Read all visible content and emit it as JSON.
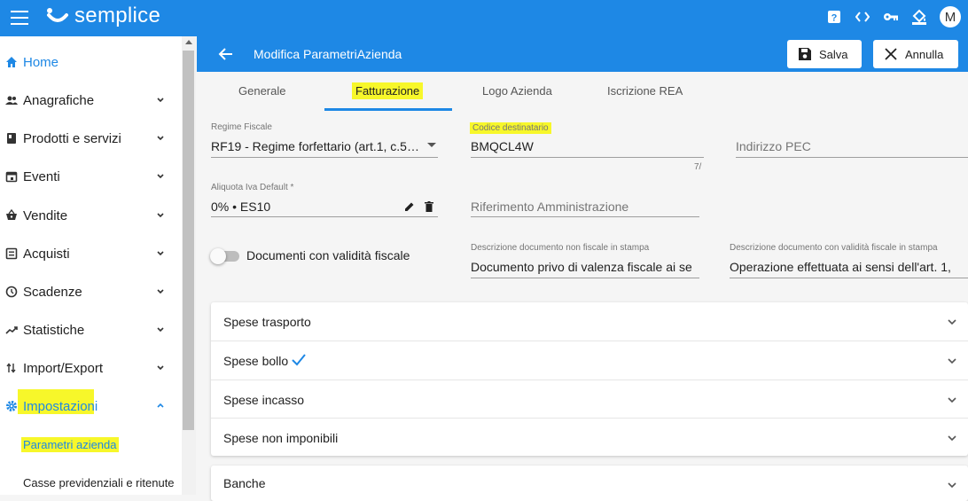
{
  "app": {
    "brand": "semplice",
    "avatar_initial": "M",
    "accent": "#1e88e5",
    "highlight": "#f7f72a"
  },
  "topbar_icons": [
    "help-icon",
    "code-icon",
    "key-icon",
    "format-paint-icon"
  ],
  "sidebar": {
    "items": [
      {
        "label": "Home",
        "icon": "home-icon",
        "active": true
      },
      {
        "label": "Anagrafiche",
        "icon": "people-icon"
      },
      {
        "label": "Prodotti e servizi",
        "icon": "book-icon"
      },
      {
        "label": "Eventi",
        "icon": "calendar-icon"
      },
      {
        "label": "Vendite",
        "icon": "basket-icon"
      },
      {
        "label": "Acquisti",
        "icon": "list-icon"
      },
      {
        "label": "Scadenze",
        "icon": "clock-icon"
      },
      {
        "label": "Statistiche",
        "icon": "trending-icon"
      },
      {
        "label": "Import/Export",
        "icon": "swap-icon"
      },
      {
        "label": "Impostazioni",
        "icon": "gear-icon",
        "active": true,
        "expanded": true
      }
    ],
    "subitems": [
      {
        "label": "Parametri azienda",
        "active": true
      },
      {
        "label": "Casse previdenziali e ritenute"
      }
    ]
  },
  "header": {
    "title": "Modifica ParametriAzienda",
    "save_label": "Salva",
    "cancel_label": "Annulla"
  },
  "tabs": [
    {
      "label": "Generale"
    },
    {
      "label": "Fatturazione",
      "active": true
    },
    {
      "label": "Logo Azienda"
    },
    {
      "label": "Iscrizione REA"
    }
  ],
  "form": {
    "regime_label": "Regime Fiscale",
    "regime_value": "RF19 - Regime forfettario (art.1, c.5…",
    "codice_label": "Codice destinatario",
    "codice_value": "BMQCL4W",
    "codice_counter": "7/",
    "pec_placeholder": "Indirizzo PEC",
    "iva_label": "Aliquota Iva Default *",
    "iva_value": "0% • ES10",
    "rif_placeholder": "Riferimento Amministrazione",
    "toggle_label": "Documenti con validità fiscale",
    "toggle_on": false,
    "desc_nf_label": "Descrizione documento non fiscale in stampa",
    "desc_nf_value": "Documento privo di valenza fiscale ai se",
    "desc_f_label": "Descrizione documento con validità fiscale in stampa",
    "desc_f_value": "Operazione effettuata ai sensi dell'art. 1,"
  },
  "panels": [
    {
      "title": "Spese trasporto"
    },
    {
      "title": "Spese bollo",
      "checked": true
    },
    {
      "title": "Spese incasso"
    },
    {
      "title": "Spese non imponibili"
    }
  ],
  "panel_extra": {
    "title": "Banche"
  }
}
